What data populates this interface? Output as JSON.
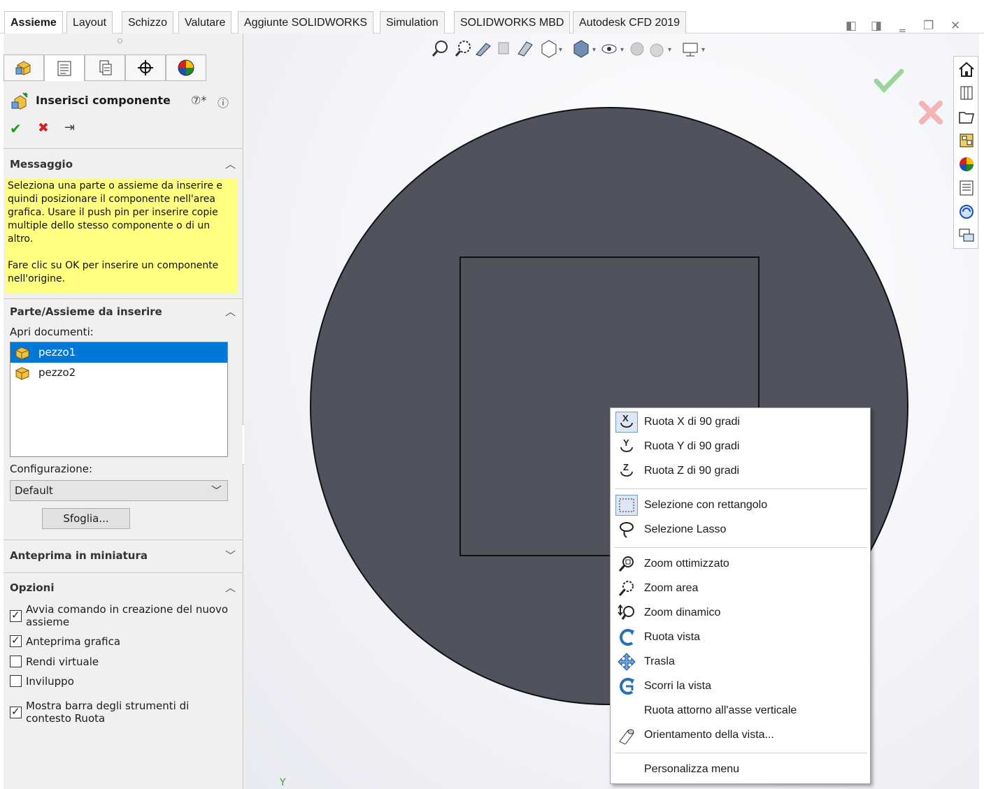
{
  "tabs": [
    {
      "label": "Assieme",
      "active": true
    },
    {
      "label": "Layout"
    },
    {
      "label": "Schizzo"
    },
    {
      "label": "Valutare"
    },
    {
      "label": "Aggiunte SOLIDWORKS"
    },
    {
      "label": "Simulation"
    },
    {
      "label": "SOLIDWORKS MBD"
    },
    {
      "label": "Autodesk CFD 2019"
    }
  ],
  "property_manager": {
    "title": "Inserisci componente",
    "message_section": {
      "title": "Messaggio",
      "text1": "Seleziona una parte o assieme da inserire e quindi posizionare il componente nell'area grafica. Usare il push pin per inserire copie multiple dello stesso componente o di un altro.",
      "text2": "Fare clic su OK per inserire un componente nell'origine."
    },
    "part_section": {
      "title": "Parte/Assieme da inserire",
      "open_docs_label": "Apri documenti:",
      "documents": [
        "pezzo1",
        "pezzo2"
      ],
      "selected_document": "pezzo1",
      "configuration_label": "Configurazione:",
      "configuration_value": "Default",
      "browse_label": "Sfoglia..."
    },
    "thumbnail_section": {
      "title": "Anteprima in miniatura"
    },
    "options_section": {
      "title": "Opzioni",
      "options": [
        {
          "label": "Avvia comando in creazione del nuovo assieme",
          "checked": true
        },
        {
          "label": "Anteprima grafica",
          "checked": true
        },
        {
          "label": "Rendi virtuale",
          "checked": false
        },
        {
          "label": "Inviluppo",
          "checked": false
        },
        {
          "label": "Mostra barra degli strumenti di contesto Ruota",
          "checked": true
        }
      ]
    }
  },
  "viewport": {
    "axis_label": "Y",
    "part_color": "#50525e",
    "edge_color": "#111111",
    "background_color": "#f2f3f8"
  },
  "context_menu": {
    "items": [
      {
        "label": "Ruota X di 90 gradi",
        "icon": "rotate-x-icon"
      },
      {
        "label": "Ruota Y di 90 gradi",
        "icon": "rotate-y-icon"
      },
      {
        "label": "Ruota Z di 90 gradi",
        "icon": "rotate-z-icon"
      },
      {
        "label": "Selezione con rettangolo",
        "icon": "box-select-icon"
      },
      {
        "label": "Selezione Lasso",
        "icon": "lasso-icon"
      },
      {
        "label": "Zoom ottimizzato",
        "icon": "zoom-fit-icon"
      },
      {
        "label": "Zoom area",
        "icon": "zoom-area-icon"
      },
      {
        "label": "Zoom dinamico",
        "icon": "zoom-dynamic-icon"
      },
      {
        "label": "Ruota vista",
        "icon": "rotate-view-icon"
      },
      {
        "label": "Trasla",
        "icon": "pan-icon"
      },
      {
        "label": "Scorri la vista",
        "icon": "roll-view-icon"
      },
      {
        "label": "Ruota attorno all'asse verticale",
        "icon": ""
      },
      {
        "label": "Orientamento della vista...",
        "icon": "view-orientation-icon"
      },
      {
        "label": "Personalizza menu",
        "icon": ""
      }
    ]
  }
}
